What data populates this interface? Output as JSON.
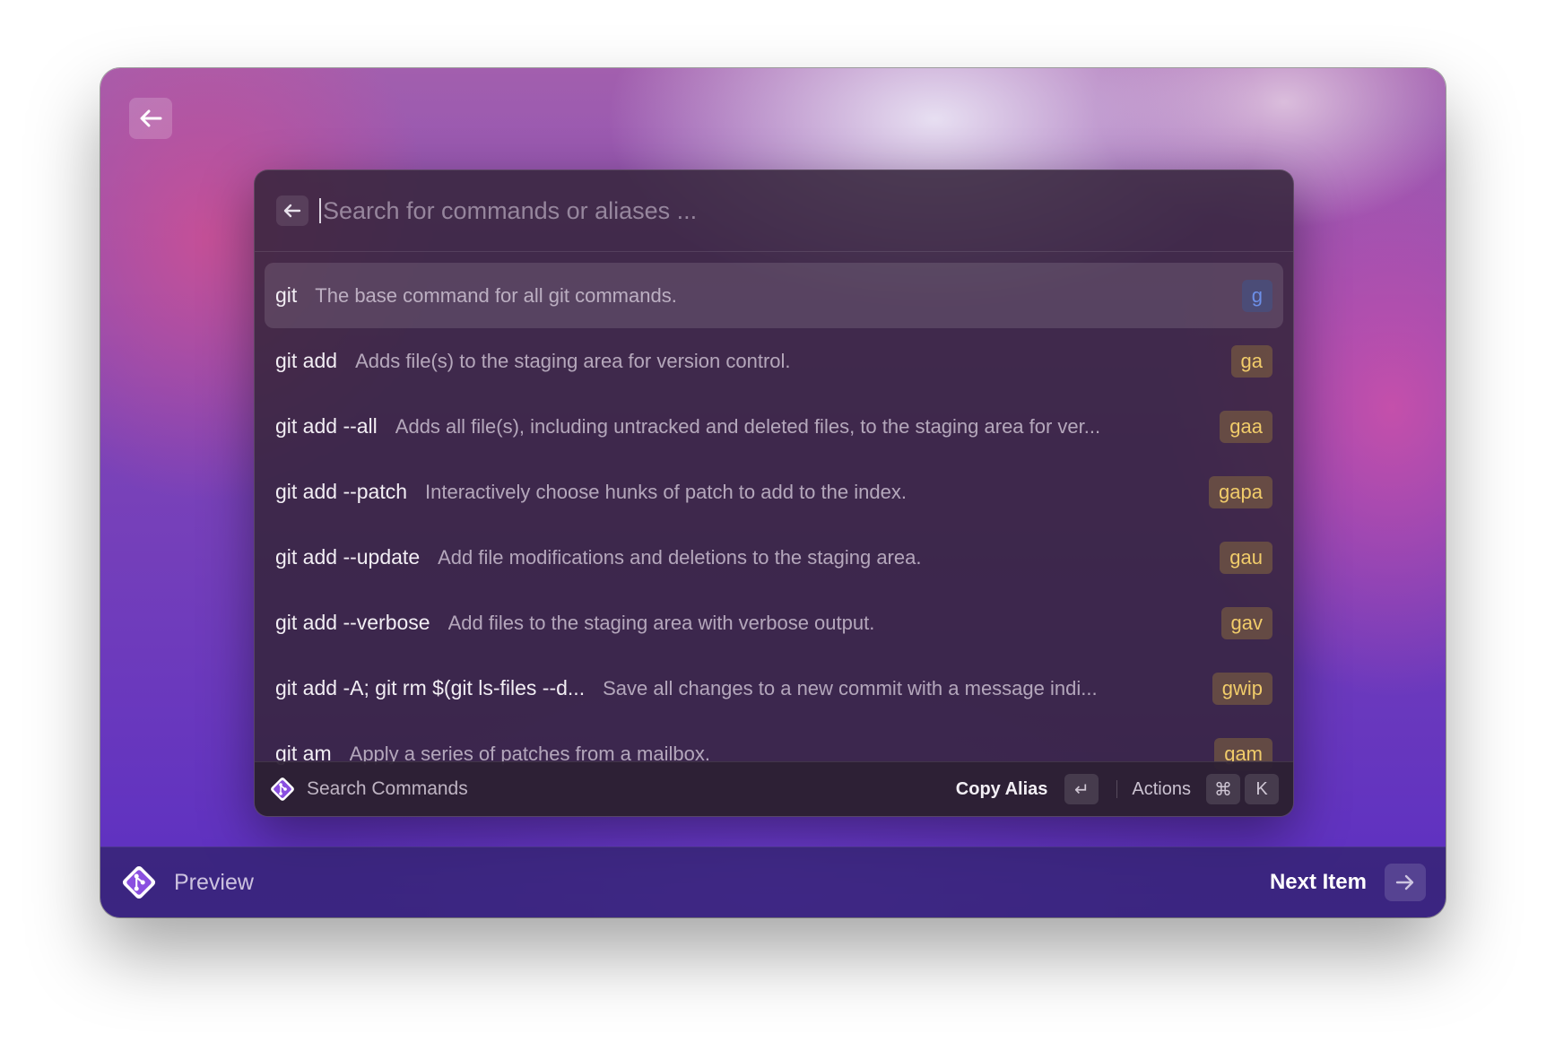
{
  "window": {
    "back_icon": "arrow-left-icon"
  },
  "search": {
    "placeholder": "Search for commands or aliases ...",
    "value": ""
  },
  "commands": [
    {
      "command": "git",
      "description": "The base command for all git commands.",
      "alias": "g",
      "selected": true
    },
    {
      "command": "git add",
      "description": "Adds file(s) to the staging area for version control.",
      "alias": "ga"
    },
    {
      "command": "git add --all",
      "description": "Adds all file(s), including untracked and deleted files, to the staging area for ver...",
      "alias": "gaa"
    },
    {
      "command": "git add --patch",
      "description": "Interactively choose hunks of patch to add to the index.",
      "alias": "gapa"
    },
    {
      "command": "git add --update",
      "description": "Add file modifications and deletions to the staging area.",
      "alias": "gau"
    },
    {
      "command": "git add --verbose",
      "description": "Add files to the staging area with verbose output.",
      "alias": "gav"
    },
    {
      "command": "git add -A; git rm $(git ls-files --d...",
      "description": "Save all changes to a new commit with a message indi...",
      "alias": "gwip"
    },
    {
      "command": "git am",
      "description": "Apply a series of patches from a mailbox.",
      "alias": "gam"
    }
  ],
  "footer": {
    "title": "Search Commands",
    "primary_action": "Copy Alias",
    "primary_key": "↵",
    "actions_label": "Actions",
    "actions_keys": [
      "⌘",
      "K"
    ]
  },
  "bottom_bar": {
    "preview_label": "Preview",
    "next_label": "Next Item",
    "next_icon": "arrow-right-icon"
  },
  "colors": {
    "alias_text": "#f1cc6a",
    "alias_selected_text": "#6d8fe8",
    "logo": "#8a4fe0"
  }
}
